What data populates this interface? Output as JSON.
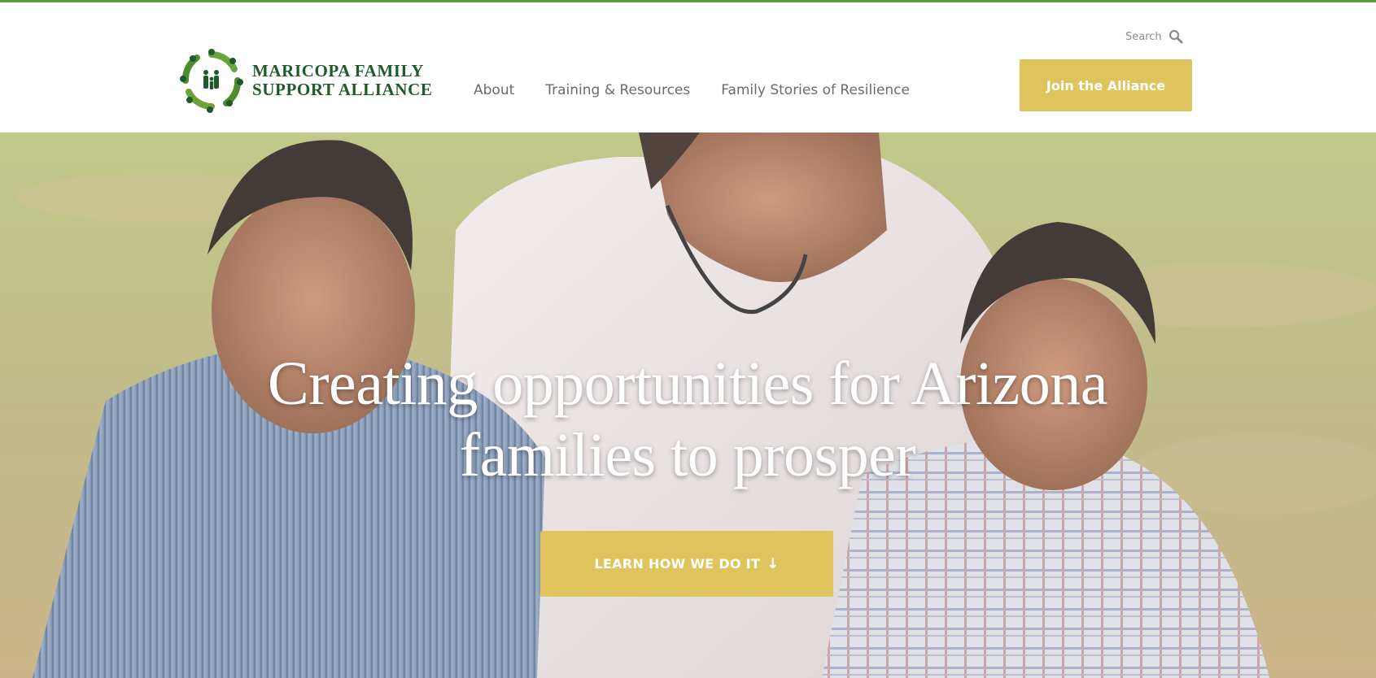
{
  "colors": {
    "accent_stripe": "#5c9a32",
    "brand_green": "#1f5b2a",
    "button_gold": "#dfc45d",
    "nav_text": "#6b6b6b"
  },
  "header": {
    "logo": {
      "line1": "MARICOPA FAMILY",
      "line2": "SUPPORT ALLIANCE",
      "icon": "family-circle-logo-icon"
    },
    "nav": [
      {
        "label": "About"
      },
      {
        "label": "Training & Resources"
      },
      {
        "label": "Family Stories of Resilience"
      }
    ],
    "search": {
      "label": "Search",
      "icon": "search-icon"
    },
    "join_label": "Join the Alliance"
  },
  "hero": {
    "title": "Creating opportunities for Arizona families to prosper",
    "cta_label": "LEARN HOW WE DO IT",
    "cta_icon": "arrow-down-icon",
    "image": "father-and-two-sons-photo"
  }
}
